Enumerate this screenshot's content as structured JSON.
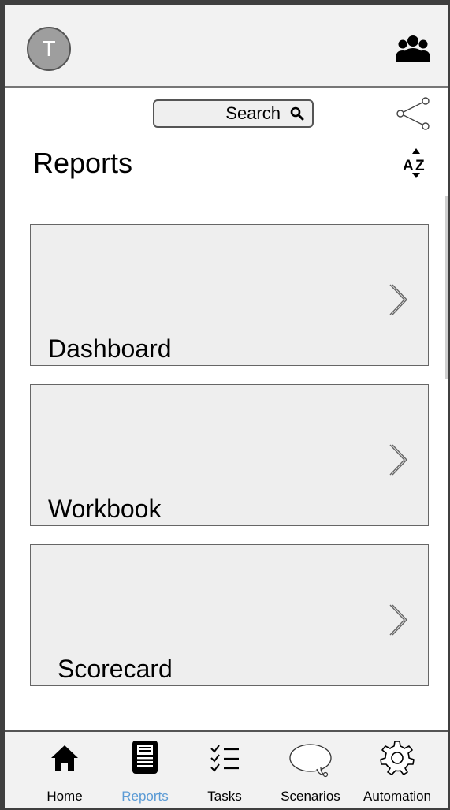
{
  "header": {
    "avatar_initial": "T",
    "avatar_icon": "avatar-circle",
    "right_icon": "people-group-icon"
  },
  "search": {
    "label": "Search",
    "icon": "magnifier-icon"
  },
  "toolbar": {
    "share_icon": "share-icon",
    "sort_icon": "sort-az-icon"
  },
  "page": {
    "title": "Reports"
  },
  "cards": [
    {
      "label": "Dashboard"
    },
    {
      "label": "Workbook"
    },
    {
      "label": "Scorecard"
    }
  ],
  "nav": {
    "active": "Reports",
    "active_color": "#5b9bd5",
    "items": [
      {
        "label": "Home",
        "icon": "home-icon"
      },
      {
        "label": "Reports",
        "icon": "report-icon"
      },
      {
        "label": "Tasks",
        "icon": "checklist-icon"
      },
      {
        "label": "Scenarios",
        "icon": "speech-bubble-icon"
      },
      {
        "label": "Automation",
        "icon": "gear-icon"
      }
    ]
  }
}
